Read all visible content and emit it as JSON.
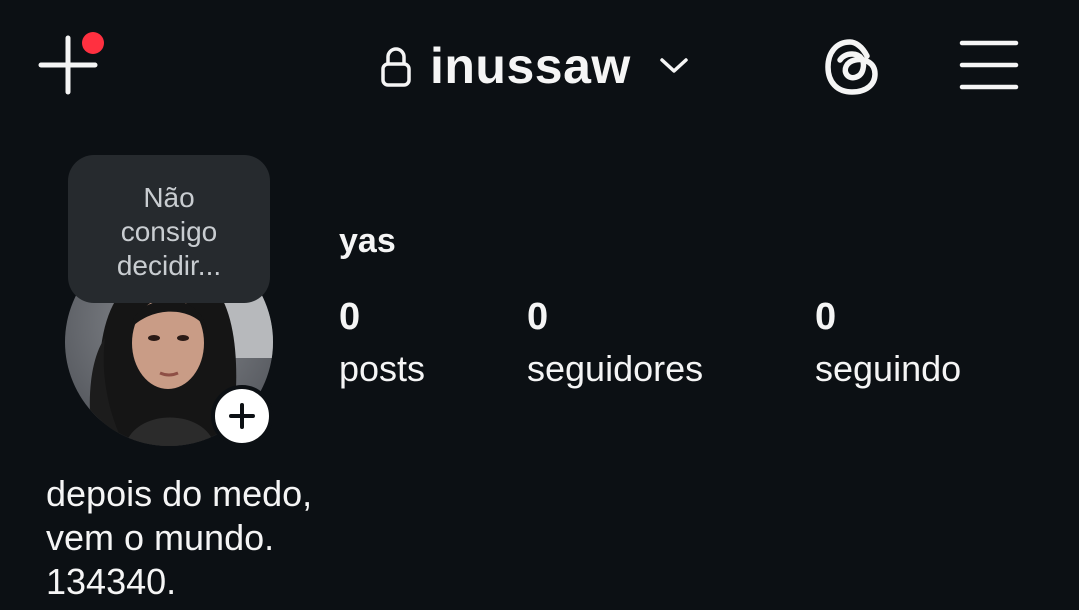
{
  "header": {
    "username": "inussaw",
    "create_icon": "plus-icon",
    "lock_icon": "lock-icon",
    "switch_icon": "chevron-down-icon",
    "threads_icon": "threads-icon",
    "menu_icon": "hamburger-menu-icon",
    "notification_dot_color": "#ff3040"
  },
  "note": {
    "text": "Não consigo decidir..."
  },
  "profile": {
    "display_name": "yas",
    "add_story_icon": "plus-icon"
  },
  "stats": [
    {
      "count": "0",
      "label": "posts"
    },
    {
      "count": "0",
      "label": "seguidores"
    },
    {
      "count": "0",
      "label": "seguindo"
    }
  ],
  "bio": {
    "lines": [
      "depois do medo,",
      "vem o mundo.",
      "134340."
    ]
  },
  "colors": {
    "background": "#0c1014",
    "text": "#f5f5f5",
    "note_bubble": "#262a2e",
    "note_text": "#c9cdd1"
  }
}
